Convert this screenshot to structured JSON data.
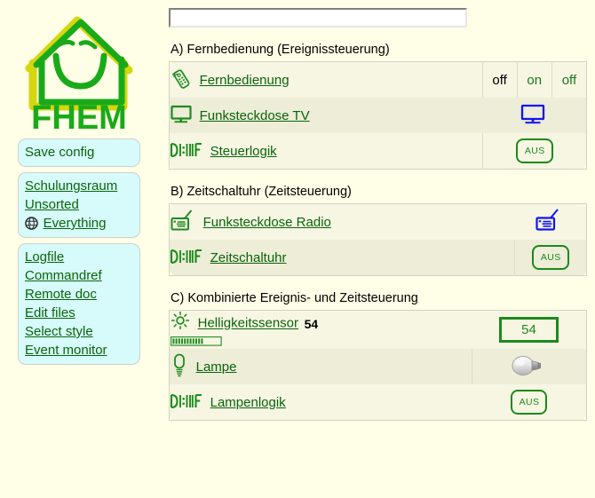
{
  "app": {
    "logo_text": "FHEM",
    "logo_alt": "fhem-house-smiley-logo"
  },
  "sidebar": {
    "save": {
      "label": "Save config"
    },
    "rooms": [
      {
        "label": "Schulungsraum",
        "icon": ""
      },
      {
        "label": "Unsorted",
        "icon": ""
      },
      {
        "label": "Everything",
        "icon": "globe-icon"
      }
    ],
    "tools": [
      {
        "label": "Logfile"
      },
      {
        "label": "Commandref"
      },
      {
        "label": "Remote doc"
      },
      {
        "label": "Edit files"
      },
      {
        "label": "Select style"
      },
      {
        "label": "Event monitor"
      }
    ]
  },
  "command_input": {
    "value": "",
    "placeholder": ""
  },
  "sections": [
    {
      "id": "a",
      "title": "A) Fernbedienung (Ereignissteuerung)",
      "rows": [
        {
          "name": "Fernbedienung",
          "icon": "remote-control-icon",
          "reading": "",
          "state_type": "commands",
          "current_state": "off",
          "set_commands": [
            "on",
            "off"
          ]
        },
        {
          "name": "Funksteckdose TV",
          "icon": "tv-icon",
          "reading": "",
          "state_type": "icon",
          "state_icon": "tv-icon-blue"
        },
        {
          "name": "Steuerlogik",
          "icon": "doif-icon",
          "reading": "",
          "state_type": "button",
          "state_label": "AUS"
        }
      ]
    },
    {
      "id": "b",
      "title": "B) Zeitschaltuhr (Zeitsteuerung)",
      "rows": [
        {
          "name": "Funksteckdose Radio",
          "icon": "radio-icon",
          "reading": "",
          "state_type": "icon",
          "state_icon": "radio-icon-blue"
        },
        {
          "name": "Zeitschaltuhr",
          "icon": "doif-icon",
          "reading": "",
          "state_type": "button",
          "state_label": "AUS"
        }
      ]
    },
    {
      "id": "c",
      "title": "C) Kombinierte Ereignis- und Zeitsteuerung",
      "rows": [
        {
          "name": "Helligkeitssensor",
          "icon": "sun-icon",
          "reading": "54",
          "gauge_percent": 70,
          "state_type": "value",
          "state_value": "54"
        },
        {
          "name": "Lampe",
          "icon": "light-bulb-icon",
          "reading": "",
          "state_type": "icon",
          "state_icon": "light-bulb-off-icon"
        },
        {
          "name": "Lampenlogik",
          "icon": "doif-icon",
          "reading": "",
          "state_type": "button",
          "state_label": "AUS"
        }
      ]
    }
  ],
  "colors": {
    "page_background": "#FFFFE7",
    "link_green": "#0A640A",
    "menu_background": "#D7FBFB",
    "row_odd": "#F6F6E3",
    "row_even": "#EDEDD8",
    "state_blue": "#1414F0",
    "accent_green": "#1C8A1C",
    "logo_green": "#19AA19",
    "logo_yellow": "#D6D60F"
  }
}
